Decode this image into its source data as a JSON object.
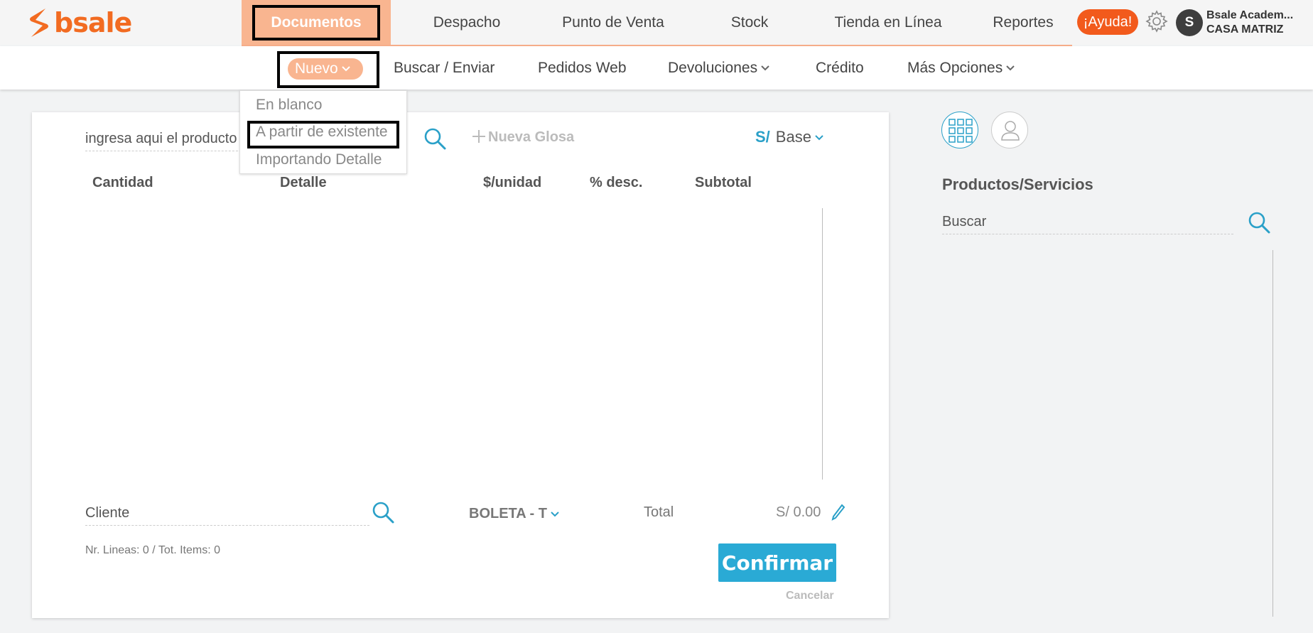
{
  "brand": {
    "name": "bsale",
    "color": "#f26b21"
  },
  "main_nav": {
    "items": [
      {
        "label": "Documentos",
        "active": true
      },
      {
        "label": "Despacho"
      },
      {
        "label": "Punto de Venta"
      },
      {
        "label": "Stock"
      },
      {
        "label": "Tienda en Línea"
      },
      {
        "label": "Reportes"
      }
    ]
  },
  "header": {
    "help_label": "¡Ayuda!",
    "avatar_initial": "S",
    "account_name": "Bsale Academ...",
    "branch": "CASA MATRIZ",
    "settings_icon": "gear-icon"
  },
  "sub_nav": {
    "items": [
      {
        "label": "Nuevo",
        "active": true,
        "has_dropdown": true
      },
      {
        "label": "Buscar / Enviar"
      },
      {
        "label": "Pedidos Web"
      },
      {
        "label": "Devoluciones",
        "has_dropdown": true
      },
      {
        "label": "Crédito"
      },
      {
        "label": "Más Opciones",
        "has_dropdown": true
      }
    ]
  },
  "nuevo_dropdown": {
    "items": [
      {
        "label": "En blanco"
      },
      {
        "label": "A partir de existente",
        "highlighted": true
      },
      {
        "label": "Importando Detalle"
      }
    ]
  },
  "document": {
    "product_placeholder": "ingresa aqui el producto",
    "new_glosa_label": "Nueva Glosa",
    "currency_symbol": "S/",
    "price_list": "Base",
    "columns": [
      "Cantidad",
      "Detalle",
      "$/unidad",
      "% desc.",
      "Subtotal"
    ],
    "client_placeholder": "Cliente",
    "doc_type": "BOLETA - T",
    "total_label": "Total",
    "total_value": "S/ 0.00",
    "lines_info": "Nr. Lineas: 0 / Tot. Items: 0",
    "confirm_label": "Confirmar",
    "cancel_label": "Cancelar"
  },
  "right_panel": {
    "title": "Productos/Servicios",
    "search_placeholder": "Buscar"
  },
  "colors": {
    "accent_orange": "#f9b590",
    "help_orange": "#f25a1c",
    "primary_blue": "#2aaad5"
  }
}
